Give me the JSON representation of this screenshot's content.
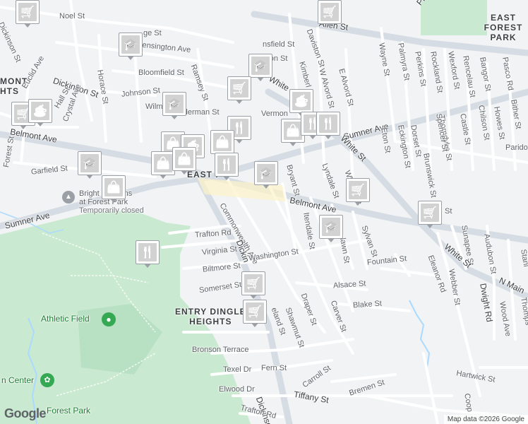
{
  "map": {
    "places": {
      "east_forest_park": "EAST FOREST\nPARK",
      "belmont_heights": "MONT\nHTS",
      "entry_dingle_heights": "ENTRY DINGLE\nHEIGHTS",
      "athletic_field": "Athletic Field",
      "bright_horizons": "Bright Horizons\nat Forest Park",
      "bright_horizons_status": "Temporarily closed",
      "forest_park": "Forest Park",
      "nature_center": "n Center",
      "east_p": "EAST P"
    },
    "streets": [
      {
        "id": "noel-st",
        "text": "Noel St"
      },
      {
        "id": "dickinson-st-nw",
        "text": "Dickinson St"
      },
      {
        "id": "allen-st",
        "text": "Allen St"
      },
      {
        "id": "plumtree-rd",
        "text": "Plumtree Ro"
      },
      {
        "id": "ridge-st",
        "text": "ge St"
      },
      {
        "id": "kensington-ave",
        "text": "Kensington Ave"
      },
      {
        "id": "ramsey-st",
        "text": "Ramsey St"
      },
      {
        "id": "mansfield-st",
        "text": "nsfield St"
      },
      {
        "id": "burton-st",
        "text": "rton St"
      },
      {
        "id": "daviston-st",
        "text": "Daviston St"
      },
      {
        "id": "kimberly-ave",
        "text": "Kimberl"
      },
      {
        "id": "w-alvord-st",
        "text": "W Alvord St"
      },
      {
        "id": "e-alvord-st",
        "text": "E Alvord St"
      },
      {
        "id": "wayne-st",
        "text": "Wayne St"
      },
      {
        "id": "palmyra-st",
        "text": "Palmyra St"
      },
      {
        "id": "perkins-st",
        "text": "Perkins St"
      },
      {
        "id": "rockland-st",
        "text": "Rockland St"
      },
      {
        "id": "wexford-st",
        "text": "Wexford St"
      },
      {
        "id": "rencelau-st",
        "text": "Rencelau St"
      },
      {
        "id": "bangor-st",
        "text": "Bangor St"
      },
      {
        "id": "pasco-rd",
        "text": "Pasco Rd"
      },
      {
        "id": "bloomfield-st",
        "text": "Bloomfield St"
      },
      {
        "id": "dickinson-st-w",
        "text": "Dickinson St"
      },
      {
        "id": "horace-st",
        "text": "Horace St"
      },
      {
        "id": "johnson-st",
        "text": "Johnson St"
      },
      {
        "id": "wilmont",
        "text": "Wilm"
      },
      {
        "id": "alderman-st",
        "text": "Alderman St"
      },
      {
        "id": "vermont",
        "text": "Vermon"
      },
      {
        "id": "white-st-n",
        "text": "White"
      },
      {
        "id": "sumner-ave-e",
        "text": "Sumner Ave"
      },
      {
        "id": "thorndyke-st",
        "text": "Thorndyke St"
      },
      {
        "id": "castle-st",
        "text": "Castle St"
      },
      {
        "id": "chilson-st",
        "text": "Chilson St"
      },
      {
        "id": "howes-st",
        "text": "Howes St"
      },
      {
        "id": "bither-st",
        "text": "Bither St"
      },
      {
        "id": "euclid-ave",
        "text": "Euclid Ave"
      },
      {
        "id": "hall-st",
        "text": "Hall St"
      },
      {
        "id": "crystal-ave",
        "text": "Crystal Ave"
      },
      {
        "id": "belmont-ave-w",
        "text": "Belmont Ave"
      },
      {
        "id": "forest-st",
        "text": "Forest St"
      },
      {
        "id": "garfield-st",
        "text": "Garfield St"
      },
      {
        "id": "eton-st",
        "text": "Eton St"
      },
      {
        "id": "eckington-st",
        "text": "Eckington St"
      },
      {
        "id": "dorset-st",
        "text": "Dorset St"
      },
      {
        "id": "brunswick-st",
        "text": "Brunswick St"
      },
      {
        "id": "spencer-st",
        "text": "Spencer St"
      },
      {
        "id": "paridon",
        "text": "Parido"
      },
      {
        "id": "white-st-mid",
        "text": "White St"
      },
      {
        "id": "bryant-st",
        "text": "Bryant St"
      },
      {
        "id": "lyndale-st",
        "text": "Lyndale St"
      },
      {
        "id": "whittier-st",
        "text": "Whittier St"
      },
      {
        "id": "belmont-ave-e",
        "text": "Belmont Ave"
      },
      {
        "id": "st-right",
        "text": "St"
      },
      {
        "id": "sumner-ave-w",
        "text": "Sumner Ave"
      },
      {
        "id": "trafton-rd",
        "text": "Trafton Rd"
      },
      {
        "id": "commonwealth-ave",
        "text": "Commonwealth Ave"
      },
      {
        "id": "itendale-st",
        "text": "Itendale St"
      },
      {
        "id": "sylvan-st",
        "text": "Sylvan St"
      },
      {
        "id": "washington-st",
        "text": "Washington St"
      },
      {
        "id": "lawn-st",
        "text": "lawn St"
      },
      {
        "id": "virginia-st",
        "text": "Virginia St"
      },
      {
        "id": "biltmore-st",
        "text": "Biltmore St"
      },
      {
        "id": "dickinson-st-s",
        "text": "Dickin"
      },
      {
        "id": "fountain-st",
        "text": "Fountain St"
      },
      {
        "id": "sunapee-st",
        "text": "Sunapee St"
      },
      {
        "id": "audubon-st",
        "text": "Audubon St"
      },
      {
        "id": "eleanor-rd",
        "text": "Eleanor Rd"
      },
      {
        "id": "white-st-s",
        "text": "White St"
      },
      {
        "id": "webber-st",
        "text": "Webber St"
      },
      {
        "id": "n-main-st",
        "text": "N Main"
      },
      {
        "id": "dwight-rd",
        "text": "Dwight Rd"
      },
      {
        "id": "wood-ave",
        "text": "Wood Ave"
      },
      {
        "id": "somerset-st",
        "text": "Somerset St"
      },
      {
        "id": "alsace-st",
        "text": "Alsace St"
      },
      {
        "id": "blake-st",
        "text": "Blake St"
      },
      {
        "id": "carver-st",
        "text": "Carver St"
      },
      {
        "id": "draper-st",
        "text": "Draper St"
      },
      {
        "id": "shawmut-st",
        "text": "Shawmut St"
      },
      {
        "id": "cleveland-st",
        "text": "eland St"
      },
      {
        "id": "bronson-terrace",
        "text": "Bronson Terrace"
      },
      {
        "id": "texel-dr",
        "text": "Texel Dr"
      },
      {
        "id": "fern-st",
        "text": "Fern St"
      },
      {
        "id": "elwood-dr",
        "text": "Elwood Dr"
      },
      {
        "id": "carroll-st",
        "text": "Carroll St"
      },
      {
        "id": "tiffany-st",
        "text": "Tiffany St"
      },
      {
        "id": "dickinson-st-se",
        "text": "Dickinso"
      },
      {
        "id": "trafton-rd-s",
        "text": "Trafton Rd"
      },
      {
        "id": "bremen-st",
        "text": "Bremen St"
      },
      {
        "id": "hartwick-st",
        "text": "Hartwick St"
      },
      {
        "id": "cooper-st",
        "text": "Coop"
      },
      {
        "id": "thompson-st",
        "text": "Thomps"
      },
      {
        "id": "stanley-st",
        "text": "Stanl"
      }
    ],
    "markers": [
      {
        "id": "m1",
        "icon": "grocery-cart-icon"
      },
      {
        "id": "m2",
        "icon": "grocery-cart-icon"
      },
      {
        "id": "m3",
        "icon": "school-cap-icon"
      },
      {
        "id": "m4",
        "icon": "school-cap-icon"
      },
      {
        "id": "m5",
        "icon": "grocery-cart-icon"
      },
      {
        "id": "m6",
        "icon": "school-cap-icon"
      },
      {
        "id": "m7",
        "icon": "coffee-cup-icon"
      },
      {
        "id": "m8",
        "icon": "grocery-cart-icon"
      },
      {
        "id": "m9",
        "icon": "coffee-cup-icon"
      },
      {
        "id": "m10",
        "icon": "restaurant-icon"
      },
      {
        "id": "m11",
        "icon": "shopping-bag-icon"
      },
      {
        "id": "m12",
        "icon": "restaurant-icon"
      },
      {
        "id": "m13",
        "icon": "restaurant-icon"
      },
      {
        "id": "m14",
        "icon": "shopping-bag-icon"
      },
      {
        "id": "m15",
        "icon": "coffee-cup-icon"
      },
      {
        "id": "m16",
        "icon": "shopping-bag-icon"
      },
      {
        "id": "m17",
        "icon": "shopping-bag-icon"
      },
      {
        "id": "m18",
        "icon": "shopping-bag-icon"
      },
      {
        "id": "m19",
        "icon": "restaurant-icon"
      },
      {
        "id": "m20",
        "icon": "school-cap-icon"
      },
      {
        "id": "m21",
        "icon": "school-cap-icon"
      },
      {
        "id": "m22",
        "icon": "shopping-bag-icon"
      },
      {
        "id": "m23",
        "icon": "grocery-cart-icon"
      },
      {
        "id": "m24",
        "icon": "school-cap-icon"
      },
      {
        "id": "m25",
        "icon": "grocery-cart-icon"
      },
      {
        "id": "m26",
        "icon": "restaurant-icon"
      },
      {
        "id": "m27",
        "icon": "grocery-cart-icon"
      },
      {
        "id": "m28",
        "icon": "grocery-cart-icon"
      }
    ],
    "branding": {
      "logo": "Google",
      "attribution": "Map data ©2026 Google"
    },
    "colors": {
      "background": "#f1f3f4",
      "park": "#c9e9d0",
      "road": "#ffffff",
      "arterial": "#d6dce3",
      "marker": "#1a4e7a",
      "water": "#aadaff",
      "poi_green": "#34a853",
      "poi_gray": "#9aa0a6"
    }
  }
}
